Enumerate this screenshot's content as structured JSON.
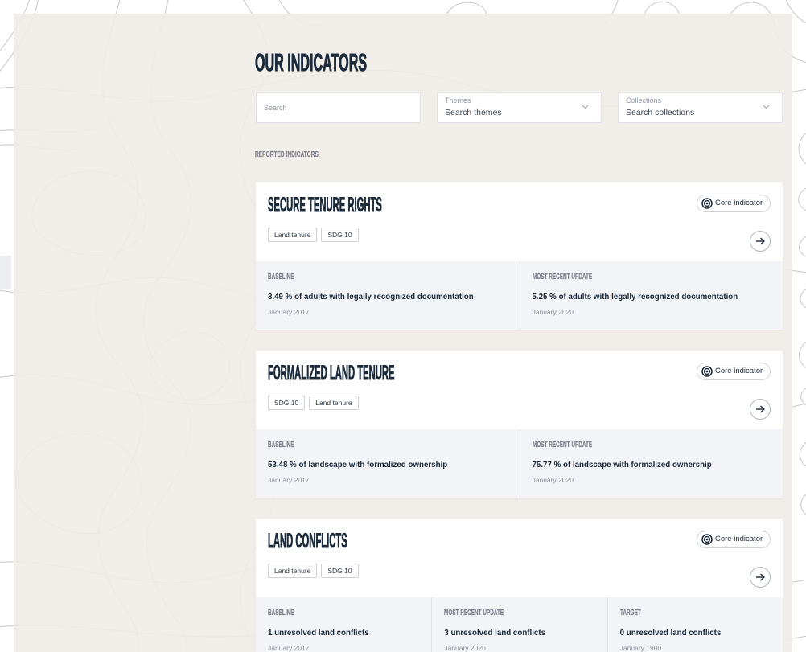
{
  "page": {
    "title": "OUR INDICATORS"
  },
  "filters": {
    "search": {
      "placeholder": "Search"
    },
    "themes": {
      "label": "Themes",
      "value": "Search themes"
    },
    "collections": {
      "label": "Collections",
      "value": "Search collections"
    }
  },
  "section_label": "REPORTED INDICATORS",
  "indicators": [
    {
      "title": "SECURE TENURE RIGHTS",
      "badge": "Core indicator",
      "tags": [
        "Land tenure",
        "SDG 10"
      ],
      "stats": [
        {
          "label": "BASELINE",
          "value": "3.49 % of adults with legally recognized documentation",
          "date": "January 2017"
        },
        {
          "label": "MOST RECENT UPDATE",
          "value": "5.25 % of adults with legally recognized documentation",
          "date": "January 2020"
        }
      ]
    },
    {
      "title": "FORMALIZED LAND TENURE",
      "badge": "Core indicator",
      "tags": [
        "SDG 10",
        "Land tenure"
      ],
      "stats": [
        {
          "label": "BASELINE",
          "value": "53.48 % of landscape with formalized ownership",
          "date": "January 2017"
        },
        {
          "label": "MOST RECENT UPDATE",
          "value": "75.77 % of landscape with formalized ownership",
          "date": "January 2020"
        }
      ]
    },
    {
      "title": "LAND CONFLICTS",
      "badge": "Core indicator",
      "tags": [
        "Land tenure",
        "SDG 10"
      ],
      "stats": [
        {
          "label": "BASELINE",
          "value": "1 unresolved land conflicts",
          "date": "January 2017"
        },
        {
          "label": "MOST RECENT UPDATE",
          "value": "3 unresolved land conflicts",
          "date": "January 2020"
        },
        {
          "label": "TARGET",
          "value": "0 unresolved land conflicts",
          "date": "January 1900"
        }
      ]
    }
  ],
  "icons": {
    "badge": "target-icon",
    "open_indicator": "arrow-right-icon",
    "dropdown": "chevron-down-icon"
  },
  "colors": {
    "ink": "#1b2a3b",
    "stats_background": "#f3f4f7",
    "muted": "#8a909a",
    "border": "#cfd3d9"
  }
}
